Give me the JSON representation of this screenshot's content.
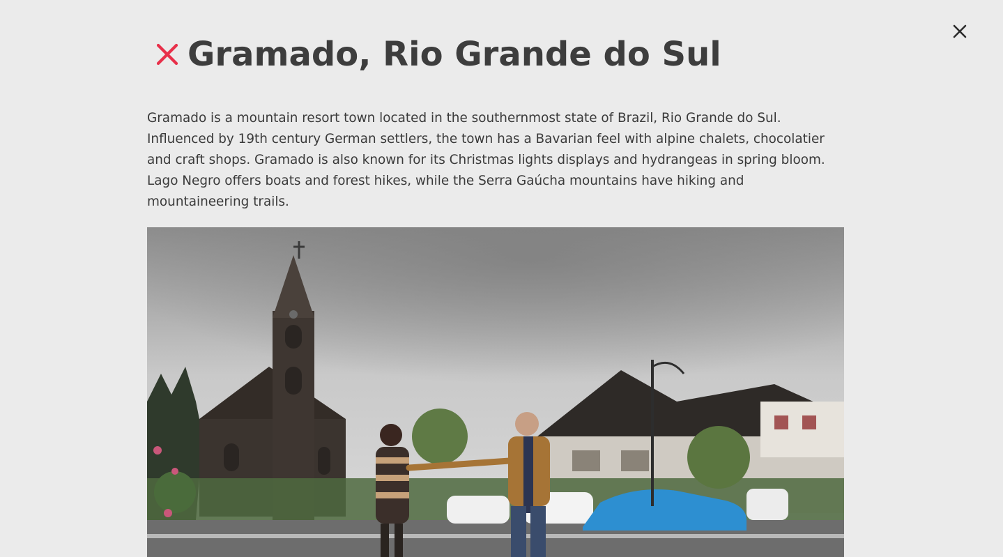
{
  "modal": {
    "title": "Gramado, Rio Grande do Sul",
    "description": "Gramado is a mountain resort town located in the southernmost state of Brazil, Rio Grande do Sul. Influenced by 19th century German settlers, the town has a Bavarian feel with alpine chalets, chocolatier and craft shops. Gramado is also known for its Christmas lights displays and hydrangeas in spring bloom. Lago Negro offers boats and forest hikes, while the Serra Gaúcha mountains have hiking and mountaineering trails.",
    "title_icon": "red-x-icon",
    "close_icon": "close-icon",
    "image_subject": "photo-of-gramado-street-with-church-and-couple"
  },
  "colors": {
    "background": "#ebebeb",
    "title_text": "#3d3d3d",
    "body_text": "#3a3a3a",
    "accent_red": "#e8304a",
    "close_icon": "#2b2b2b"
  }
}
